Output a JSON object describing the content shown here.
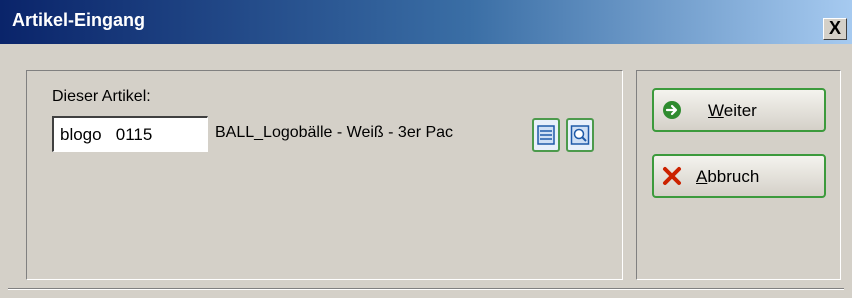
{
  "window": {
    "title": "Artikel-Eingang",
    "close_glyph": "X"
  },
  "form": {
    "article_label": "Dieser Artikel:",
    "article_value": "blogo   0115",
    "article_description": "BALL_Logobälle - Weiß - 3er Pac",
    "icons": [
      "list-icon",
      "search-icon"
    ]
  },
  "buttons": {
    "weiter": {
      "mnemonic": "W",
      "rest": "eiter",
      "icon": "arrow-right-icon",
      "accent": "#2e8b2e"
    },
    "abbruch": {
      "mnemonic": "A",
      "rest": "bbruch",
      "icon": "red-x-icon",
      "accent": "#cc2200"
    }
  }
}
